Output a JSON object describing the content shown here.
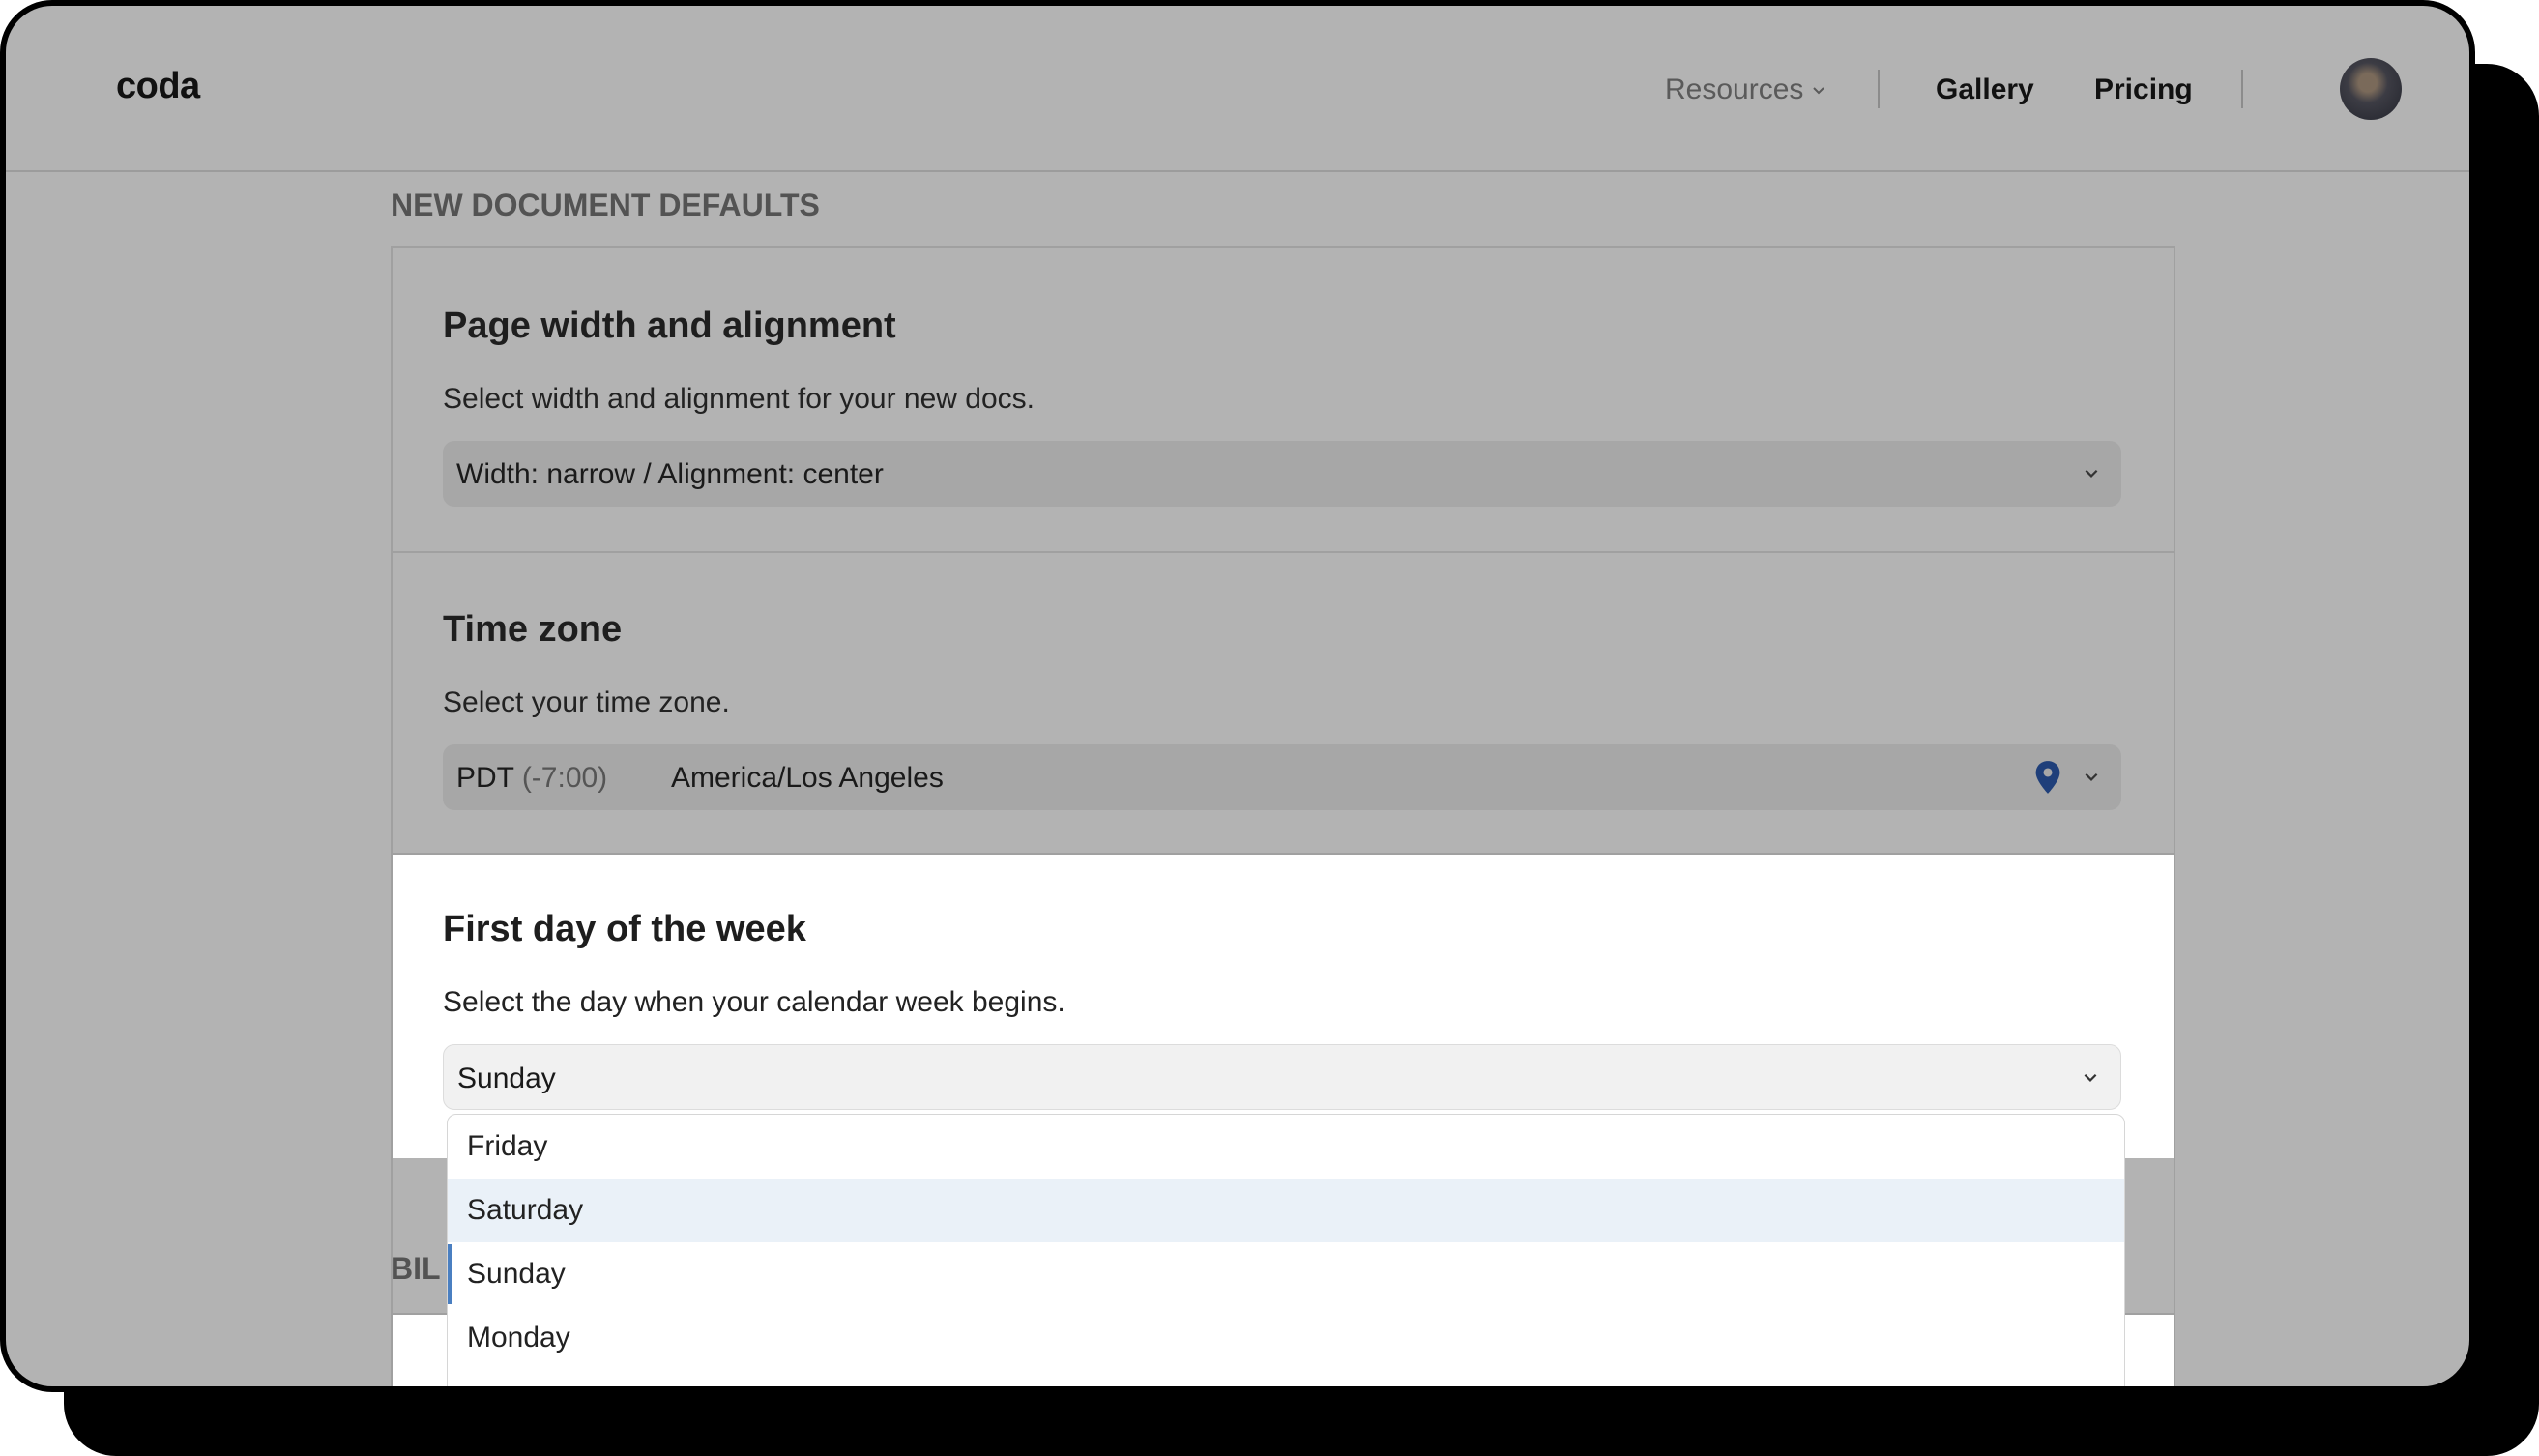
{
  "header": {
    "logo": "coda",
    "nav": {
      "resources": "Resources",
      "gallery": "Gallery",
      "pricing": "Pricing"
    }
  },
  "section_heading": "NEW DOCUMENT DEFAULTS",
  "page_width": {
    "title": "Page width and alignment",
    "description": "Select width and alignment for your new docs.",
    "value": "Width: narrow / Alignment: center"
  },
  "time_zone": {
    "title": "Time zone",
    "description": "Select your time zone.",
    "abbr": "PDT",
    "offset": "(-7:00)",
    "name": "America/Los Angeles"
  },
  "first_day": {
    "title": "First day of the week",
    "description": "Select the day when your calendar week begins.",
    "value": "Sunday",
    "options": [
      "Friday",
      "Saturday",
      "Sunday",
      "Monday"
    ],
    "hovered": "Saturday",
    "selected": "Sunday"
  },
  "next_section_partial": "BIL",
  "colors": {
    "overlay": "#b3b3b3",
    "pin": "#1f3f7a",
    "selected_bar": "#4a7fc1",
    "hover_bg": "#eaf1f8"
  }
}
